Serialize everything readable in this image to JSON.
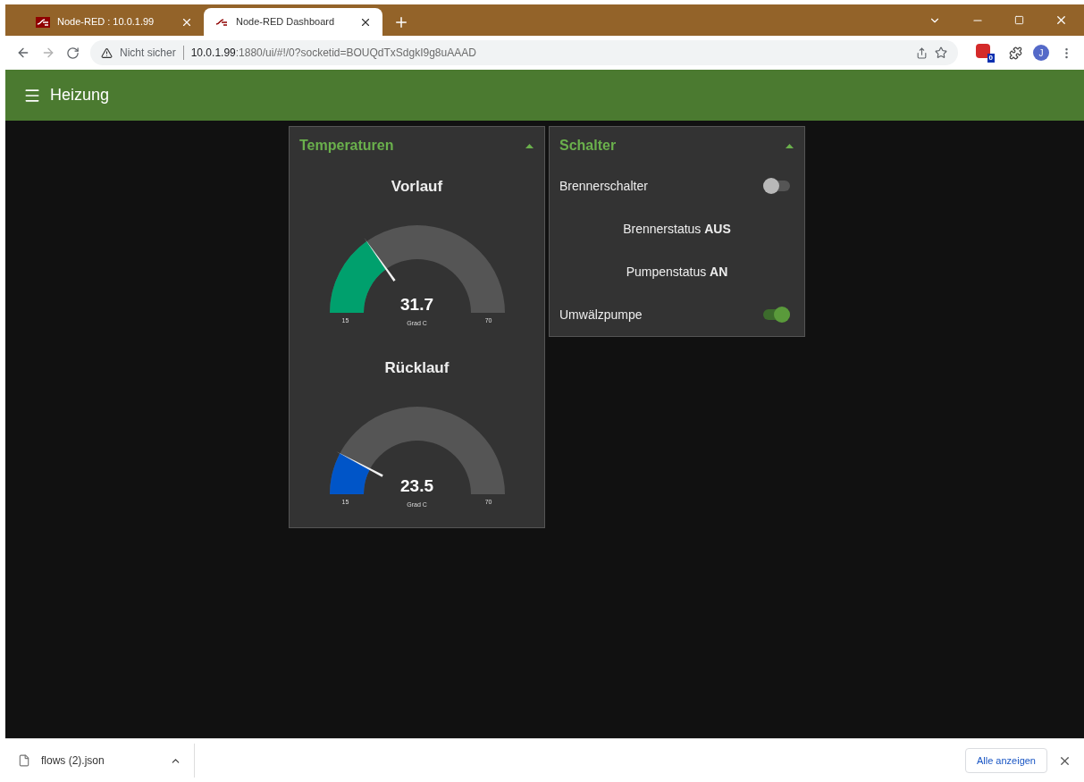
{
  "browser": {
    "tabs": [
      {
        "title": "Node-RED : 10.0.1.99",
        "selected": false
      },
      {
        "title": "Node-RED Dashboard",
        "selected": true
      }
    ],
    "security": "Nicht sicher",
    "url_host": "10.0.1.99",
    "url_rest": ":1880/ui/#!/0?socketid=BOUQdTxSdgkI9g8uAAAD",
    "extension_badge": "0",
    "profile": "J"
  },
  "header": {
    "title": "Heizung"
  },
  "groups": [
    {
      "title": "Temperaturen",
      "expanded": true,
      "widgets": [
        {
          "kind": "gauge",
          "title": "Vorlauf",
          "value": "31.7",
          "unit": "Grad C",
          "min": "15",
          "max": "70",
          "color": "#00a06d"
        },
        {
          "kind": "gauge",
          "title": "Rücklauf",
          "value": "23.5",
          "unit": "Grad C",
          "min": "15",
          "max": "70",
          "color": "#0055c8"
        }
      ]
    },
    {
      "title": "Schalter",
      "expanded": true,
      "widgets": [
        {
          "kind": "switch",
          "label": "Brennerschalter",
          "on": false
        },
        {
          "kind": "text",
          "text": "Brennerstatus **AUS**"
        },
        {
          "kind": "text",
          "text": "Pumpenstatus **AN**"
        },
        {
          "kind": "switch",
          "label": "Umwälzpumpe",
          "on": true
        }
      ]
    }
  ],
  "downloads": {
    "file": "flows (2).json",
    "show_all": "Alle anzeigen"
  }
}
